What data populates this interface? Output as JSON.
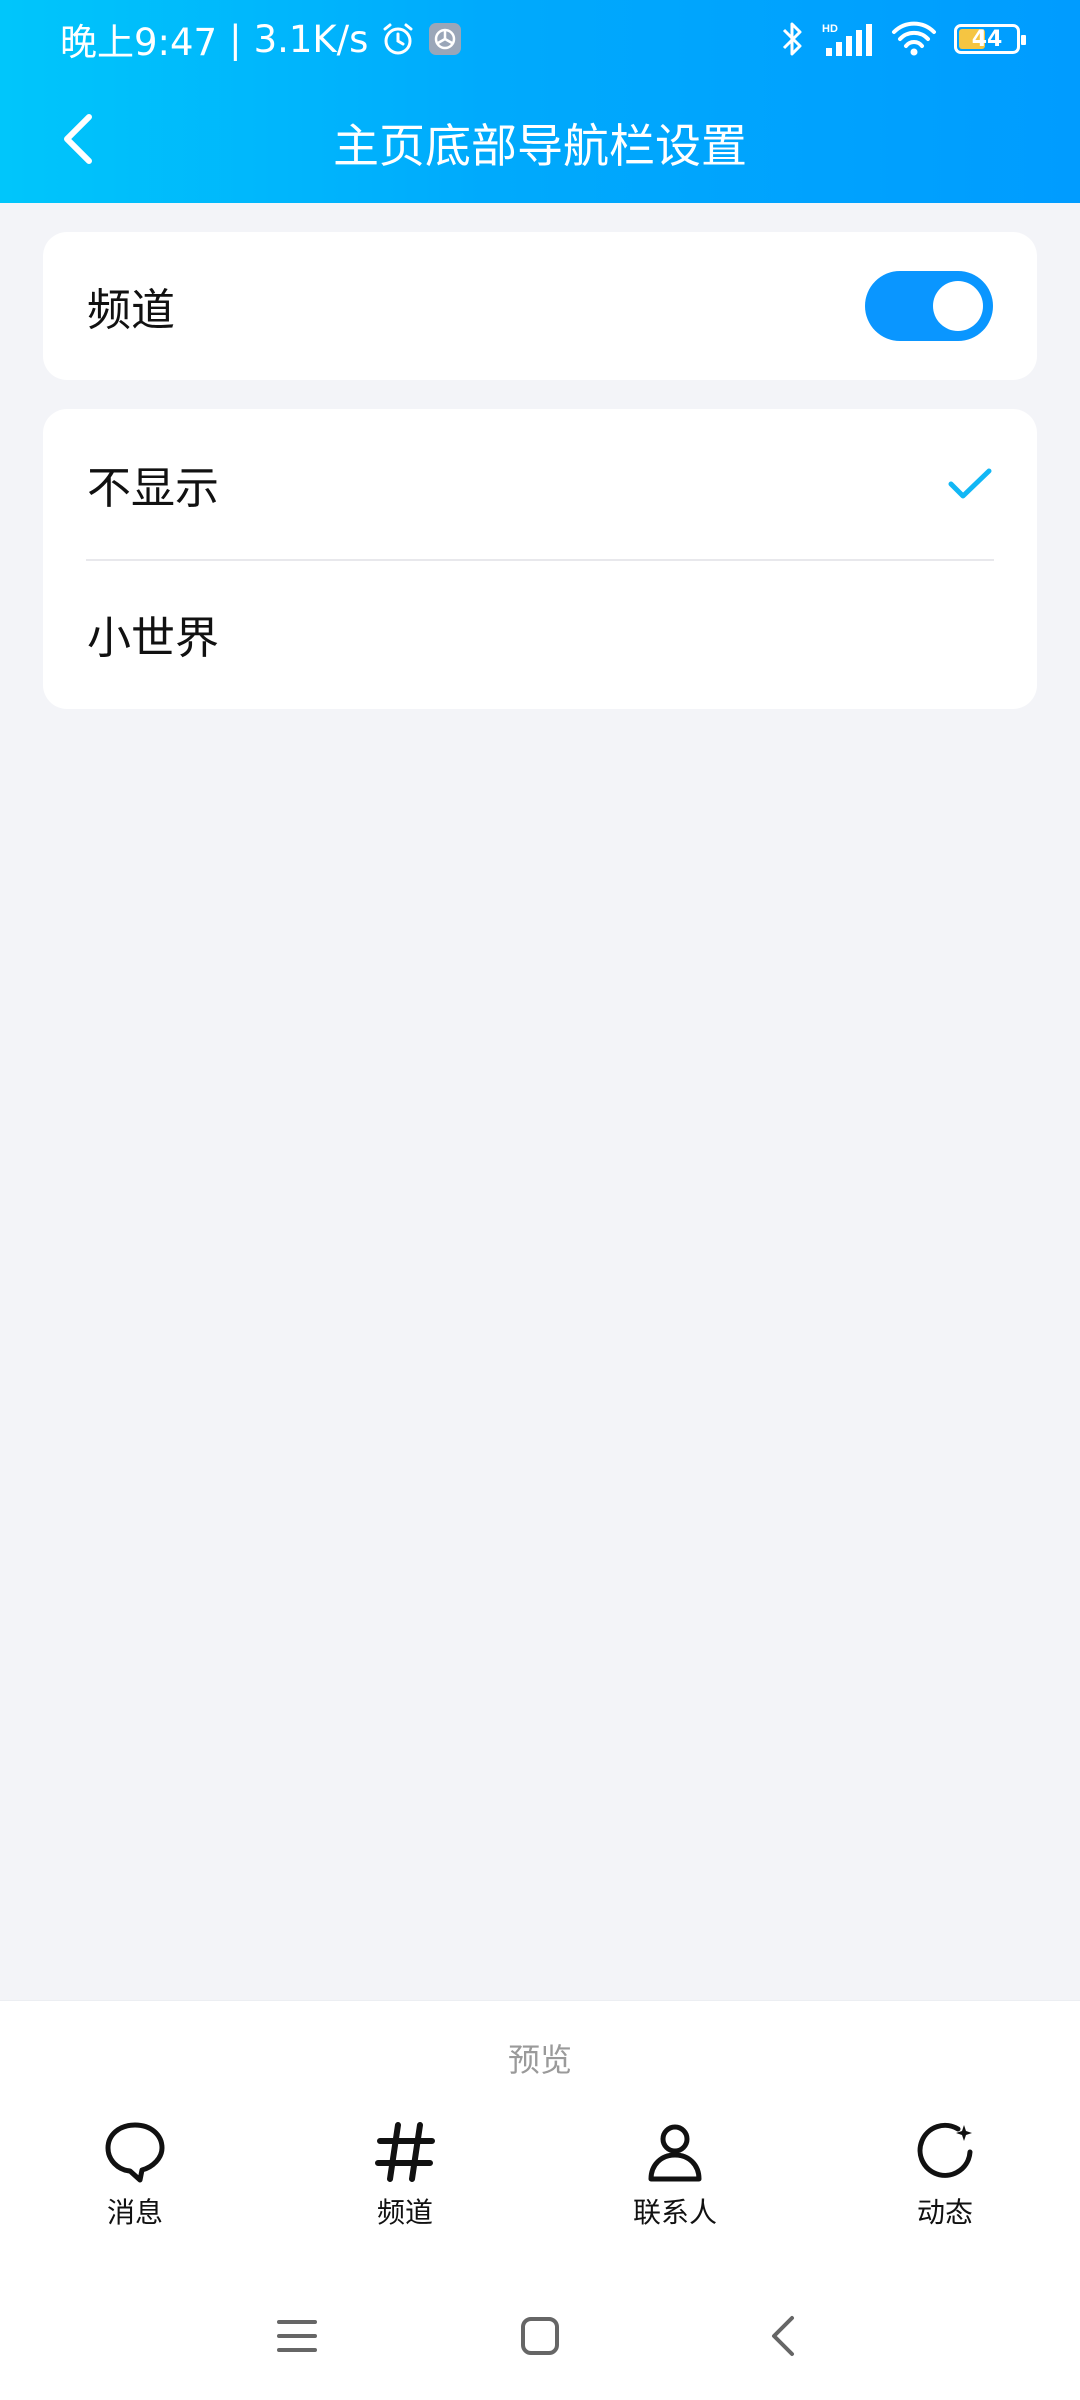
{
  "status_bar": {
    "time": "晚上9:47",
    "separator": "|",
    "net_speed": "3.1K/s",
    "battery": "44",
    "icons": [
      "alarm-icon",
      "app-icon",
      "bluetooth-icon",
      "signal-hd-icon",
      "wifi-icon",
      "battery-icon"
    ]
  },
  "header": {
    "title": "主页底部导航栏设置",
    "back_icon": "chevron-left-icon",
    "gradient": [
      "#00c6fb",
      "#009cff"
    ]
  },
  "settings": {
    "toggle_row": {
      "label": "频道",
      "enabled": true,
      "accent": "#0a96ff"
    },
    "options": [
      {
        "label": "不显示",
        "selected": true
      },
      {
        "label": "小世界",
        "selected": false
      }
    ],
    "check_color": "#12b7f5"
  },
  "preview": {
    "label": "预览",
    "nav_items": [
      {
        "label": "消息",
        "icon": "chat-bubble-icon"
      },
      {
        "label": "频道",
        "icon": "hashtag-icon"
      },
      {
        "label": "联系人",
        "icon": "person-icon"
      },
      {
        "label": "动态",
        "icon": "refresh-star-icon"
      }
    ]
  },
  "system_nav": [
    "menu-icon",
    "home-icon",
    "back-icon"
  ]
}
